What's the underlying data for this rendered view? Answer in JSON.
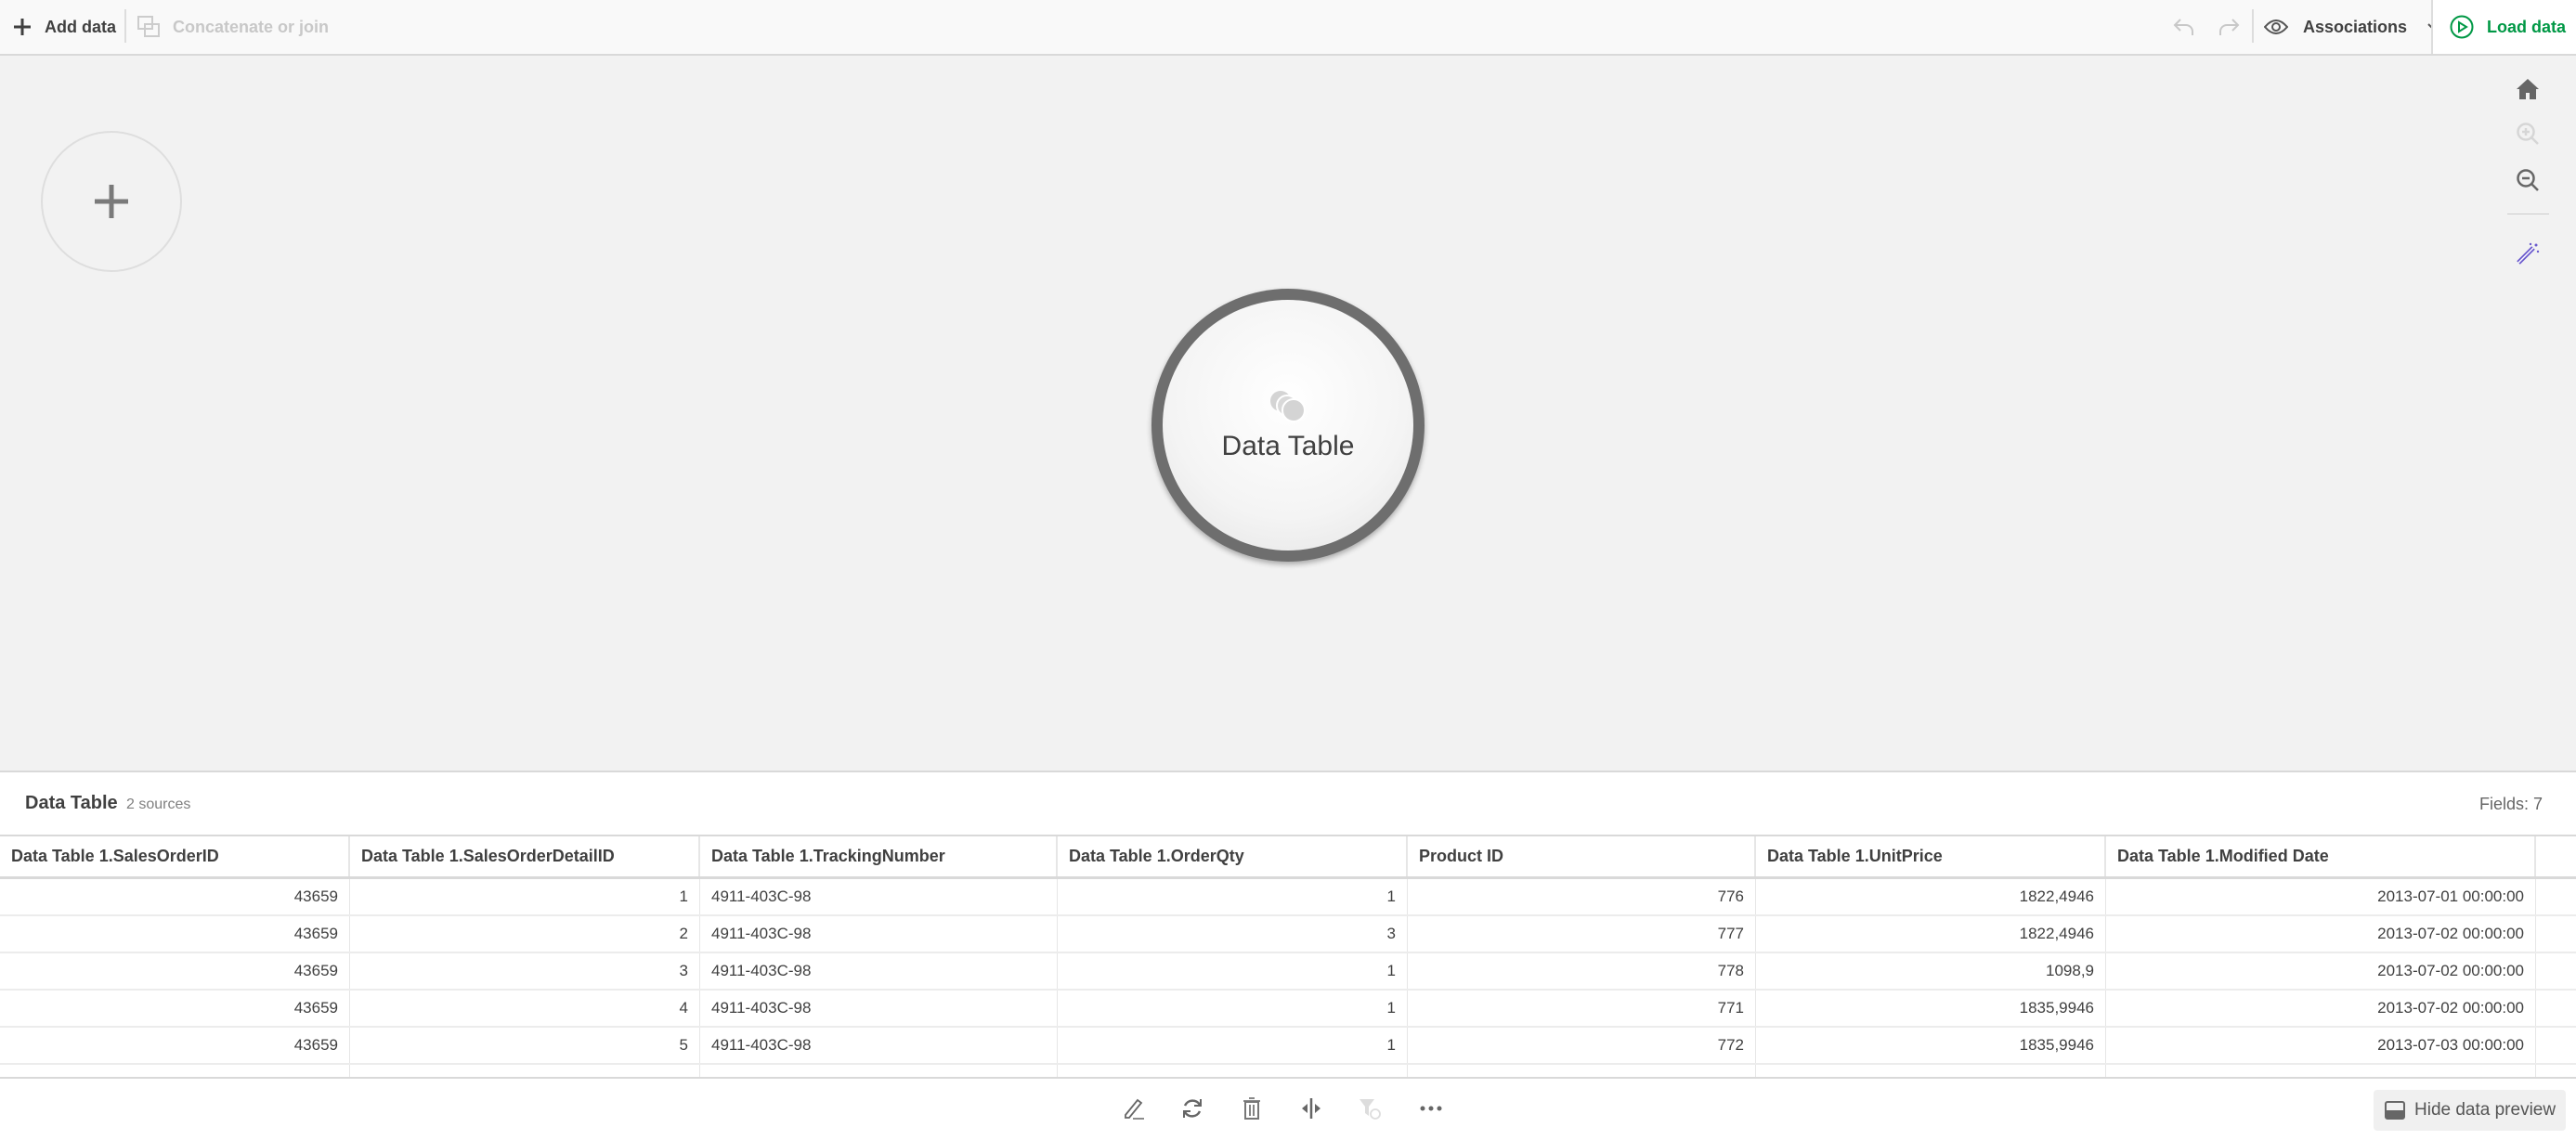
{
  "toolbar": {
    "add_data": "Add data",
    "concatenate": "Concatenate or join",
    "view_mode": "Associations",
    "load_data": "Load data",
    "accent_color": "#009845"
  },
  "canvas": {
    "node_label": "Data Table"
  },
  "preview": {
    "title": "Data Table",
    "sources": "2 sources",
    "fields": "Fields: 7",
    "columns": [
      "Data Table 1.SalesOrderID",
      "Data Table 1.SalesOrderDetailID",
      "Data Table 1.TrackingNumber",
      "Data Table 1.OrderQty",
      "Product ID",
      "Data Table 1.UnitPrice",
      "Data Table 1.Modified Date"
    ],
    "rows": [
      [
        "43659",
        "1",
        "4911-403C-98",
        "1",
        "776",
        "1822,4946",
        "2013-07-01 00:00:00"
      ],
      [
        "43659",
        "2",
        "4911-403C-98",
        "3",
        "777",
        "1822,4946",
        "2013-07-02 00:00:00"
      ],
      [
        "43659",
        "3",
        "4911-403C-98",
        "1",
        "778",
        "1098,9",
        "2013-07-02 00:00:00"
      ],
      [
        "43659",
        "4",
        "4911-403C-98",
        "1",
        "771",
        "1835,9946",
        "2013-07-02 00:00:00"
      ],
      [
        "43659",
        "5",
        "4911-403C-98",
        "1",
        "772",
        "1835,9946",
        "2013-07-03 00:00:00"
      ]
    ]
  },
  "bottom": {
    "hide_preview": "Hide data preview"
  }
}
